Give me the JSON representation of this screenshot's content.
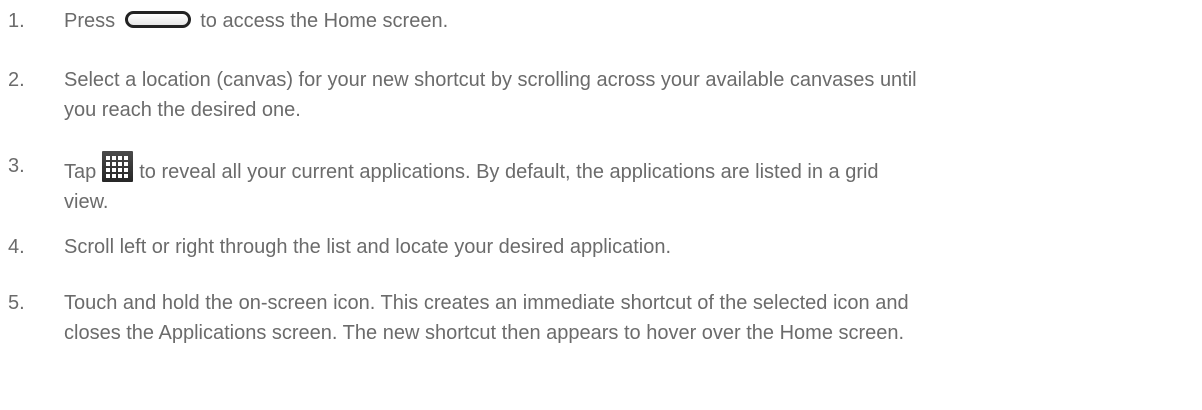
{
  "steps": [
    {
      "number": "1.",
      "before_icon": "Press",
      "icon": "home-button-icon",
      "after_icon": "to access the Home screen."
    },
    {
      "number": "2.",
      "line1": "Select a location (canvas) for your new shortcut by scrolling across your available canvases until",
      "line2": "you reach the desired one."
    },
    {
      "number": "3.",
      "before_icon": "Tap",
      "icon": "apps-grid-icon",
      "after_icon_line1": "to reveal all your current applications. By default, the applications are listed in a grid",
      "line2": "view."
    },
    {
      "number": "4.",
      "text": "Scroll left or right through the list and locate your desired application."
    },
    {
      "number": "5.",
      "line1": "Touch and hold the on-screen icon. This creates an immediate shortcut of the selected icon and",
      "line2": "closes the Applications screen. The new shortcut then appears to hover over the Home screen."
    }
  ],
  "colors": {
    "text": "#6b6b6b",
    "icon_dark": "#262626",
    "icon_grid": "#ffffff"
  }
}
